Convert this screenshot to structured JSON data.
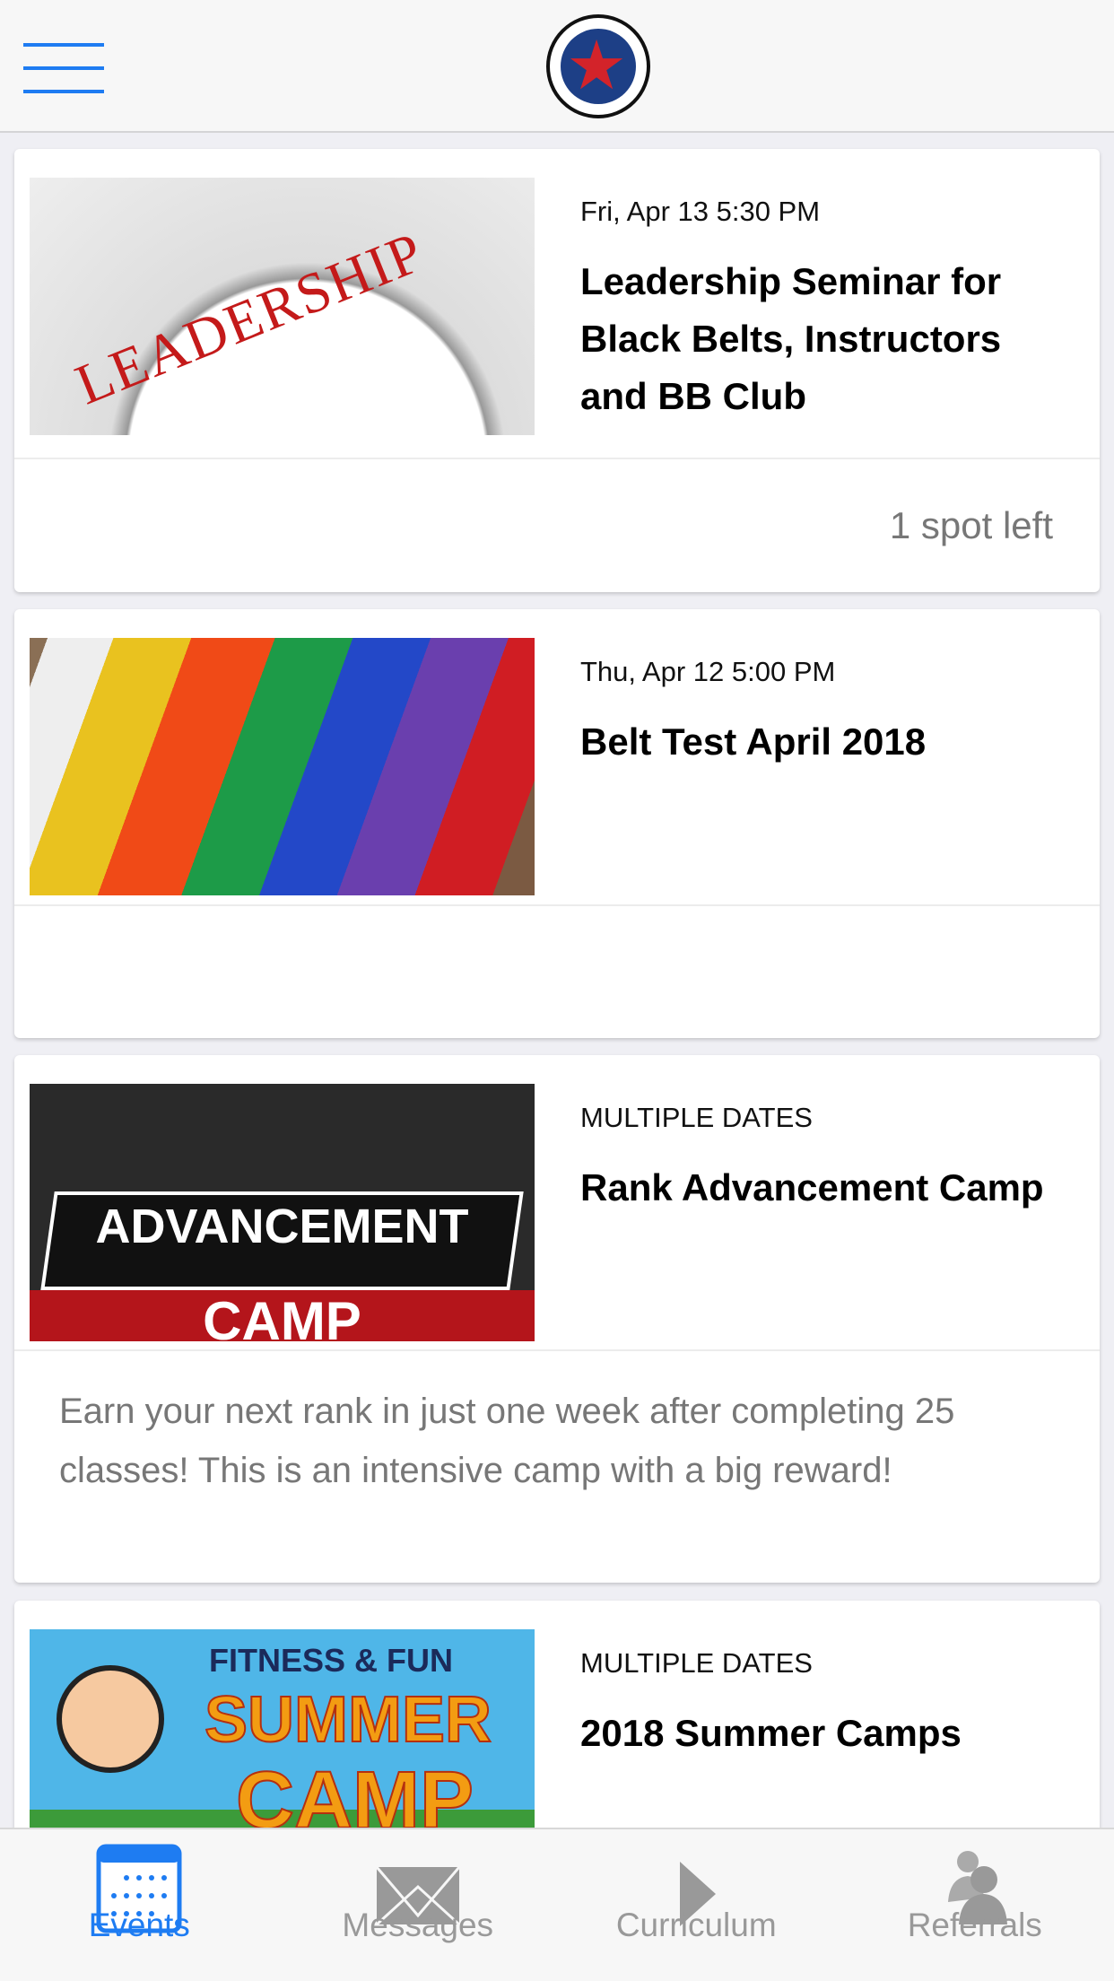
{
  "header": {
    "menu_icon": "hamburger-icon",
    "logo_alt": "Allstar Martial Arts Academy"
  },
  "events": [
    {
      "date": "Fri, Apr 13 5:30 PM",
      "title": "Leadership Seminar for Black Belts, Instructors and BB Club",
      "footer": "1 spot left",
      "image_text": "LEADERSHIP"
    },
    {
      "date": "Thu, Apr 12 5:00 PM",
      "title": "Belt Test April 2018",
      "footer": ""
    },
    {
      "date": "MULTIPLE DATES",
      "title": "Rank Advancement Camp",
      "footer": "Earn your next rank in just one week after completing 25 classes! This is an intensive camp with a big reward!",
      "image_text": [
        "ADVANCEMENT",
        "CAMP"
      ]
    },
    {
      "date": "MULTIPLE DATES",
      "title": "2018 Summer Camps",
      "image_text": [
        "FITNESS & FUN",
        "SUMMER",
        "CAMP"
      ]
    }
  ],
  "tabs": [
    {
      "label": "Events",
      "icon": "calendar-icon",
      "active": true
    },
    {
      "label": "Messages",
      "icon": "envelope-icon"
    },
    {
      "label": "Curriculum",
      "icon": "play-icon"
    },
    {
      "label": "Referrals",
      "icon": "people-icon"
    }
  ],
  "colors": {
    "accent": "#1e7cf2",
    "inactive": "#999999"
  }
}
